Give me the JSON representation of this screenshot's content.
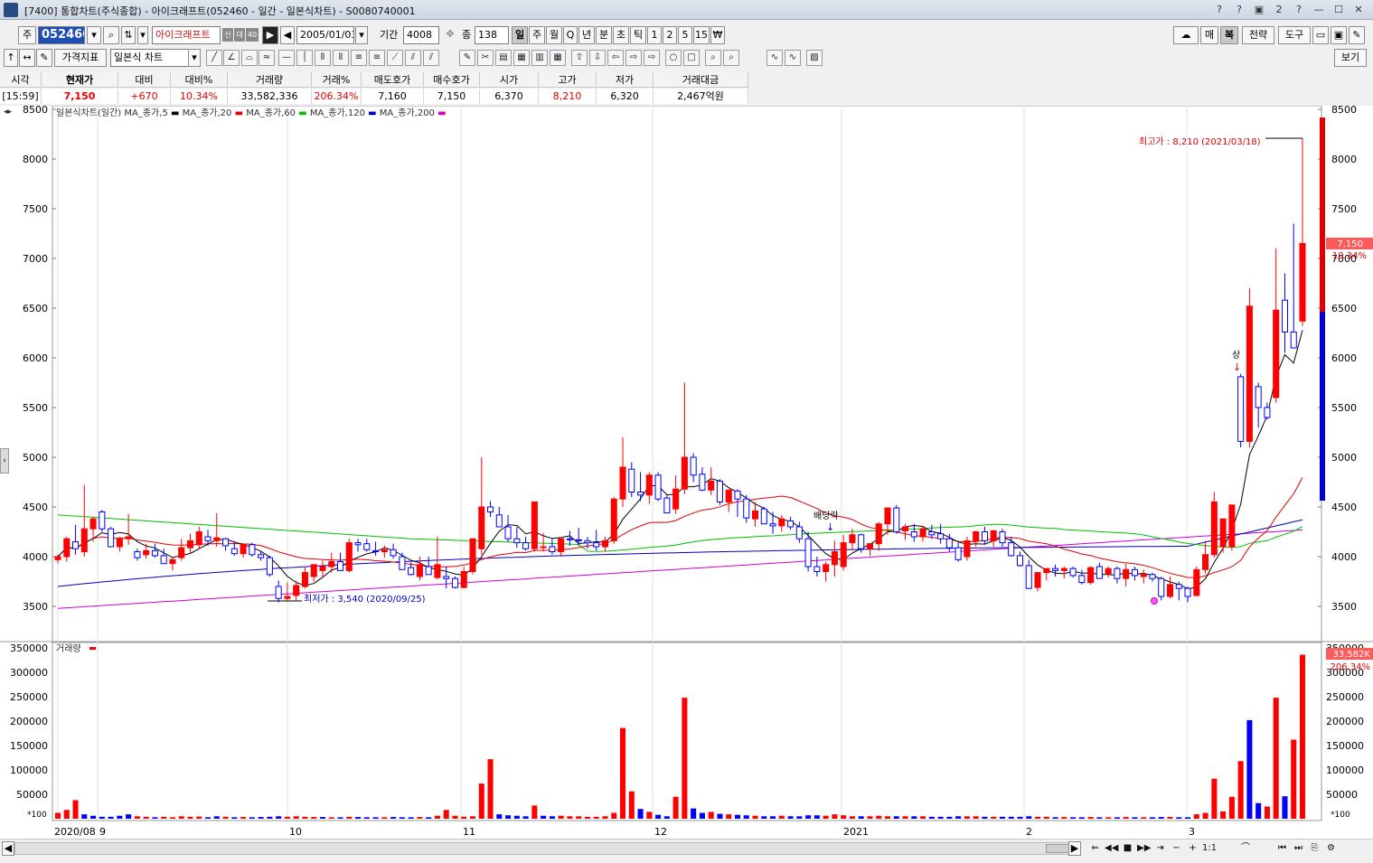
{
  "window": {
    "title": "[7400] 통합차트(주식종합) - 아이크래프트(052460 - 일간 - 일본식차트) - S0080740001",
    "controls": [
      "?",
      "?",
      "▣",
      "2",
      "?",
      "—",
      "☐",
      "✕"
    ]
  },
  "toolbar": {
    "market_prefix": "주",
    "code": "052460",
    "stock_name": "아이크래프트",
    "badges": [
      "신",
      "대",
      "40"
    ],
    "date": "2005/01/03",
    "period_label": "기간",
    "period_value": "4008",
    "count_label": "종",
    "count_value": "138",
    "interval_buttons": [
      "일",
      "주",
      "월",
      "Q",
      "년",
      "분",
      "초",
      "틱",
      "1",
      "2",
      "5",
      "15",
      "₩"
    ],
    "interval_selected": "일",
    "right_buttons": [
      "매",
      "복",
      "전략",
      "도구"
    ],
    "view_button": "보기",
    "indicator_button": "가격지표",
    "chart_type": "일본식 차트"
  },
  "quote": {
    "headers": [
      "시각",
      "현재가",
      "대비",
      "대비%",
      "거래량",
      "거래%",
      "매도호가",
      "매수호가",
      "시가",
      "고가",
      "저가",
      "거래대금"
    ],
    "values": [
      "[15:59]",
      "7,150",
      "+670",
      "10.34%",
      "33,582,336",
      "206.34%",
      "7,160",
      "7,150",
      "6,370",
      "8,210",
      "6,320",
      "2,467억원"
    ]
  },
  "chart_data": {
    "type": "candlestick",
    "legend": "일본식차트(일간)",
    "series": [
      {
        "name": "MA_종가,5",
        "color": "#000000"
      },
      {
        "name": "MA_종가,20",
        "color": "#e00000"
      },
      {
        "name": "MA_종가,60",
        "color": "#00c000"
      },
      {
        "name": "MA_종가,120",
        "color": "#0000c0"
      },
      {
        "name": "MA_종가,200",
        "color": "#d000d0"
      }
    ],
    "price_ylim": [
      3300,
      8500
    ],
    "price_ticks": [
      3500,
      4000,
      4500,
      5000,
      5500,
      6000,
      6500,
      7000,
      7500,
      8000,
      8500
    ],
    "x_labels": [
      "2020/08",
      "9",
      "10",
      "11",
      "12",
      "2021",
      "2",
      "3"
    ],
    "annotations": {
      "high": "최고가 : 8,210 (2021/03/18)",
      "low": "최저가 : 3,540 (2020/09/25)",
      "ex_dividend": "배당락",
      "limit_up": "상"
    },
    "current_price_label": "7,150",
    "current_change_label": "10.34%",
    "volume_legend": "거래량",
    "volume_ylim": [
      0,
      350000
    ],
    "volume_ticks": [
      50000,
      100000,
      150000,
      200000,
      250000,
      300000,
      350000
    ],
    "volume_unit": "*100",
    "current_volume_label": "33,582K",
    "current_volume_pct": "206.34%",
    "candles": [
      [
        3970,
        4020,
        3930,
        4000
      ],
      [
        4000,
        4200,
        3950,
        4180
      ],
      [
        4150,
        4320,
        4020,
        4080
      ],
      [
        4050,
        4720,
        4000,
        4280
      ],
      [
        4280,
        4400,
        4150,
        4380
      ],
      [
        4450,
        4470,
        4250,
        4280
      ],
      [
        4280,
        4300,
        4100,
        4100
      ],
      [
        4100,
        4200,
        4050,
        4180
      ],
      [
        4180,
        4430,
        4120,
        4200
      ],
      [
        4050,
        4080,
        3960,
        3990
      ],
      [
        4020,
        4130,
        3980,
        4060
      ],
      [
        4060,
        4130,
        3990,
        4010
      ],
      [
        4010,
        4080,
        3940,
        3930
      ],
      [
        3930,
        4000,
        3860,
        3970
      ],
      [
        3990,
        4180,
        3960,
        4090
      ],
      [
        4090,
        4230,
        4040,
        4160
      ],
      [
        4120,
        4300,
        4080,
        4250
      ],
      [
        4200,
        4270,
        4110,
        4160
      ],
      [
        4160,
        4440,
        4100,
        4190
      ],
      [
        4180,
        4190,
        4060,
        4110
      ],
      [
        4080,
        4150,
        4010,
        4030
      ],
      [
        4030,
        4130,
        3990,
        4120
      ],
      [
        4120,
        4140,
        4000,
        4020
      ],
      [
        4020,
        4060,
        3960,
        3990
      ],
      [
        3990,
        4010,
        3800,
        3820
      ],
      [
        3700,
        3760,
        3540,
        3580
      ],
      [
        3580,
        3740,
        3560,
        3600
      ],
      [
        3610,
        3760,
        3560,
        3710
      ],
      [
        3700,
        3900,
        3680,
        3840
      ],
      [
        3800,
        3920,
        3750,
        3920
      ],
      [
        3860,
        3960,
        3790,
        3900
      ],
      [
        3900,
        4040,
        3840,
        3950
      ],
      [
        3950,
        4040,
        3880,
        3860
      ],
      [
        3860,
        4180,
        3840,
        4140
      ],
      [
        4140,
        4180,
        4050,
        4120
      ],
      [
        4130,
        4180,
        4050,
        4070
      ],
      [
        4060,
        4150,
        4010,
        4050
      ],
      [
        4050,
        4110,
        3990,
        4070
      ],
      [
        4070,
        4130,
        3980,
        4010
      ],
      [
        4000,
        4040,
        3900,
        3870
      ],
      [
        3890,
        3940,
        3810,
        3820
      ],
      [
        3800,
        4000,
        3760,
        3920
      ],
      [
        3900,
        4000,
        3820,
        3820
      ],
      [
        3790,
        4200,
        3770,
        3920
      ],
      [
        3800,
        3900,
        3680,
        3780
      ],
      [
        3780,
        3800,
        3680,
        3690
      ],
      [
        3690,
        3900,
        3680,
        3850
      ],
      [
        3850,
        3980,
        3820,
        4180
      ],
      [
        4080,
        5000,
        4020,
        4500
      ],
      [
        4500,
        4560,
        4400,
        4450
      ],
      [
        4420,
        4500,
        4300,
        4300
      ],
      [
        4300,
        4420,
        4150,
        4180
      ],
      [
        4180,
        4300,
        4090,
        4140
      ],
      [
        4140,
        4200,
        4060,
        4080
      ],
      [
        4080,
        4540,
        4050,
        4550
      ],
      [
        4100,
        4240,
        4050,
        4100
      ],
      [
        4100,
        4180,
        4020,
        4050
      ],
      [
        4050,
        4180,
        4000,
        4180
      ],
      [
        4180,
        4260,
        4110,
        4170
      ],
      [
        4170,
        4290,
        4110,
        4160
      ],
      [
        4160,
        4200,
        4080,
        4140
      ],
      [
        4140,
        4270,
        4060,
        4100
      ],
      [
        4100,
        4200,
        4050,
        4160
      ],
      [
        4160,
        4600,
        4130,
        4580
      ],
      [
        4580,
        5200,
        4500,
        4900
      ],
      [
        4880,
        4950,
        4600,
        4650
      ],
      [
        4650,
        4850,
        4560,
        4620
      ],
      [
        4620,
        4850,
        4530,
        4820
      ],
      [
        4820,
        4850,
        4560,
        4580
      ],
      [
        4590,
        4620,
        4500,
        4440
      ],
      [
        4480,
        4820,
        4430,
        4680
      ],
      [
        4680,
        5750,
        4630,
        5000
      ],
      [
        5000,
        5040,
        4750,
        4820
      ],
      [
        4830,
        4900,
        4660,
        4670
      ],
      [
        4670,
        4900,
        4620,
        4760
      ],
      [
        4760,
        4780,
        4520,
        4550
      ],
      [
        4550,
        4680,
        4450,
        4670
      ],
      [
        4660,
        4680,
        4400,
        4580
      ],
      [
        4580,
        4620,
        4340,
        4390
      ],
      [
        4380,
        4550,
        4300,
        4460
      ],
      [
        4480,
        4500,
        4340,
        4330
      ],
      [
        4330,
        4450,
        4230,
        4310
      ],
      [
        4310,
        4420,
        4250,
        4380
      ],
      [
        4360,
        4400,
        4270,
        4300
      ],
      [
        4300,
        4350,
        4140,
        4180
      ],
      [
        4180,
        4250,
        3850,
        3900
      ],
      [
        3900,
        4000,
        3800,
        3850
      ],
      [
        3850,
        3950,
        3750,
        3920
      ],
      [
        3920,
        4160,
        3800,
        4050
      ],
      [
        3900,
        4220,
        3860,
        4140
      ],
      [
        4140,
        4280,
        4060,
        4220
      ],
      [
        4220,
        4230,
        4040,
        4080
      ],
      [
        4080,
        4120,
        4010,
        4130
      ],
      [
        4130,
        4350,
        4060,
        4330
      ],
      [
        4330,
        4490,
        4220,
        4490
      ],
      [
        4490,
        4520,
        4230,
        4250
      ],
      [
        4260,
        4330,
        4170,
        4300
      ],
      [
        4250,
        4330,
        4150,
        4200
      ],
      [
        4200,
        4310,
        4150,
        4280
      ],
      [
        4250,
        4320,
        4180,
        4220
      ],
      [
        4230,
        4330,
        4130,
        4180
      ],
      [
        4180,
        4230,
        4050,
        4090
      ],
      [
        4090,
        4140,
        3950,
        3970
      ],
      [
        4000,
        4200,
        3960,
        4160
      ],
      [
        4160,
        4260,
        4100,
        4250
      ],
      [
        4250,
        4300,
        4120,
        4160
      ],
      [
        4160,
        4270,
        4100,
        4260
      ],
      [
        4250,
        4280,
        4100,
        4140
      ],
      [
        4140,
        4200,
        4000,
        4010
      ],
      [
        4010,
        4050,
        3900,
        3910
      ],
      [
        3910,
        3970,
        3680,
        3680
      ],
      [
        3690,
        3760,
        3650,
        3840
      ],
      [
        3840,
        3880,
        3760,
        3880
      ],
      [
        3880,
        3920,
        3800,
        3860
      ],
      [
        3860,
        3900,
        3780,
        3880
      ],
      [
        3880,
        3900,
        3790,
        3810
      ],
      [
        3810,
        3870,
        3720,
        3740
      ],
      [
        3740,
        3900,
        3720,
        3890
      ],
      [
        3900,
        3940,
        3780,
        3780
      ],
      [
        3830,
        3900,
        3790,
        3880
      ],
      [
        3880,
        3900,
        3730,
        3780
      ],
      [
        3780,
        3930,
        3700,
        3870
      ],
      [
        3870,
        3900,
        3760,
        3810
      ],
      [
        3800,
        3870,
        3730,
        3820
      ],
      [
        3820,
        3840,
        3750,
        3780
      ],
      [
        3780,
        3800,
        3560,
        3600
      ],
      [
        3600,
        3800,
        3580,
        3720
      ],
      [
        3720,
        3750,
        3560,
        3680
      ],
      [
        3680,
        3700,
        3540,
        3600
      ],
      [
        3610,
        3900,
        3600,
        3870
      ],
      [
        3870,
        4160,
        3830,
        4020
      ],
      [
        4020,
        4650,
        3990,
        4550
      ],
      [
        4100,
        4250,
        4040,
        4380
      ],
      [
        4100,
        4500,
        4060,
        4520
      ],
      [
        5810,
        5840,
        5100,
        5160
      ],
      [
        5160,
        6700,
        5100,
        6520
      ],
      [
        5710,
        5750,
        5300,
        5500
      ],
      [
        5500,
        5550,
        5380,
        5400
      ],
      [
        5600,
        7100,
        5550,
        6480
      ],
      [
        6580,
        6850,
        6050,
        6260
      ],
      [
        6260,
        7350,
        6120,
        6100
      ],
      [
        6370,
        8210,
        6320,
        7150
      ]
    ],
    "volumes": [
      [
        12000,
        1
      ],
      [
        18000,
        1
      ],
      [
        38000,
        1
      ],
      [
        9000,
        0
      ],
      [
        6000,
        0
      ],
      [
        4000,
        0
      ],
      [
        4000,
        0
      ],
      [
        6000,
        0
      ],
      [
        9000,
        0
      ],
      [
        5000,
        1
      ],
      [
        4000,
        1
      ],
      [
        3000,
        0
      ],
      [
        4000,
        1
      ],
      [
        3000,
        1
      ],
      [
        5000,
        1
      ],
      [
        4000,
        1
      ],
      [
        4500,
        1
      ],
      [
        3000,
        0
      ],
      [
        5000,
        0
      ],
      [
        4000,
        1
      ],
      [
        3000,
        0
      ],
      [
        3500,
        1
      ],
      [
        3000,
        0
      ],
      [
        3500,
        0
      ],
      [
        4000,
        0
      ],
      [
        5000,
        0
      ],
      [
        4000,
        1
      ],
      [
        5000,
        1
      ],
      [
        4000,
        1
      ],
      [
        3500,
        1
      ],
      [
        3500,
        0
      ],
      [
        3000,
        1
      ],
      [
        3000,
        0
      ],
      [
        4000,
        1
      ],
      [
        3500,
        0
      ],
      [
        3000,
        0
      ],
      [
        3000,
        0
      ],
      [
        3000,
        1
      ],
      [
        3500,
        0
      ],
      [
        3000,
        0
      ],
      [
        3000,
        0
      ],
      [
        3500,
        1
      ],
      [
        3000,
        0
      ],
      [
        6000,
        1
      ],
      [
        18000,
        1
      ],
      [
        6000,
        1
      ],
      [
        4000,
        1
      ],
      [
        5000,
        1
      ],
      [
        72000,
        1
      ],
      [
        122000,
        1
      ],
      [
        9000,
        0
      ],
      [
        7000,
        0
      ],
      [
        6000,
        0
      ],
      [
        5000,
        0
      ],
      [
        27000,
        1
      ],
      [
        6000,
        0
      ],
      [
        5000,
        0
      ],
      [
        6000,
        1
      ],
      [
        5000,
        1
      ],
      [
        5000,
        1
      ],
      [
        4000,
        1
      ],
      [
        4000,
        1
      ],
      [
        5000,
        1
      ],
      [
        12000,
        1
      ],
      [
        186000,
        1
      ],
      [
        56000,
        1
      ],
      [
        20000,
        0
      ],
      [
        14000,
        1
      ],
      [
        8000,
        0
      ],
      [
        5000,
        0
      ],
      [
        45000,
        1
      ],
      [
        248000,
        1
      ],
      [
        21000,
        0
      ],
      [
        12000,
        0
      ],
      [
        14000,
        1
      ],
      [
        10000,
        0
      ],
      [
        9000,
        1
      ],
      [
        8000,
        0
      ],
      [
        7000,
        0
      ],
      [
        6000,
        1
      ],
      [
        5000,
        0
      ],
      [
        5000,
        0
      ],
      [
        6000,
        1
      ],
      [
        5000,
        0
      ],
      [
        5000,
        0
      ],
      [
        7000,
        0
      ],
      [
        7000,
        0
      ],
      [
        6000,
        1
      ],
      [
        9000,
        1
      ],
      [
        7000,
        1
      ],
      [
        5000,
        1
      ],
      [
        5000,
        0
      ],
      [
        5000,
        1
      ],
      [
        6000,
        1
      ],
      [
        5000,
        1
      ],
      [
        5000,
        0
      ],
      [
        5000,
        1
      ],
      [
        5000,
        0
      ],
      [
        5000,
        1
      ],
      [
        4000,
        0
      ],
      [
        4000,
        0
      ],
      [
        4000,
        0
      ],
      [
        5000,
        0
      ],
      [
        5000,
        1
      ],
      [
        5000,
        1
      ],
      [
        4000,
        0
      ],
      [
        4000,
        1
      ],
      [
        4000,
        0
      ],
      [
        4000,
        0
      ],
      [
        4000,
        0
      ],
      [
        5000,
        0
      ],
      [
        4000,
        1
      ],
      [
        4000,
        1
      ],
      [
        3000,
        0
      ],
      [
        3500,
        1
      ],
      [
        3000,
        0
      ],
      [
        3000,
        0
      ],
      [
        3500,
        1
      ],
      [
        3000,
        0
      ],
      [
        3000,
        1
      ],
      [
        3000,
        0
      ],
      [
        3500,
        1
      ],
      [
        3000,
        0
      ],
      [
        3000,
        1
      ],
      [
        3000,
        0
      ],
      [
        3500,
        0
      ],
      [
        3500,
        1
      ],
      [
        3000,
        0
      ],
      [
        3000,
        0
      ],
      [
        9000,
        1
      ],
      [
        12000,
        1
      ],
      [
        82000,
        1
      ],
      [
        15000,
        1
      ],
      [
        45000,
        1
      ],
      [
        118000,
        1
      ],
      [
        202000,
        0
      ],
      [
        32000,
        0
      ],
      [
        25000,
        1
      ],
      [
        248000,
        1
      ],
      [
        46000,
        0
      ],
      [
        162000,
        1
      ],
      [
        336000,
        1
      ]
    ]
  }
}
